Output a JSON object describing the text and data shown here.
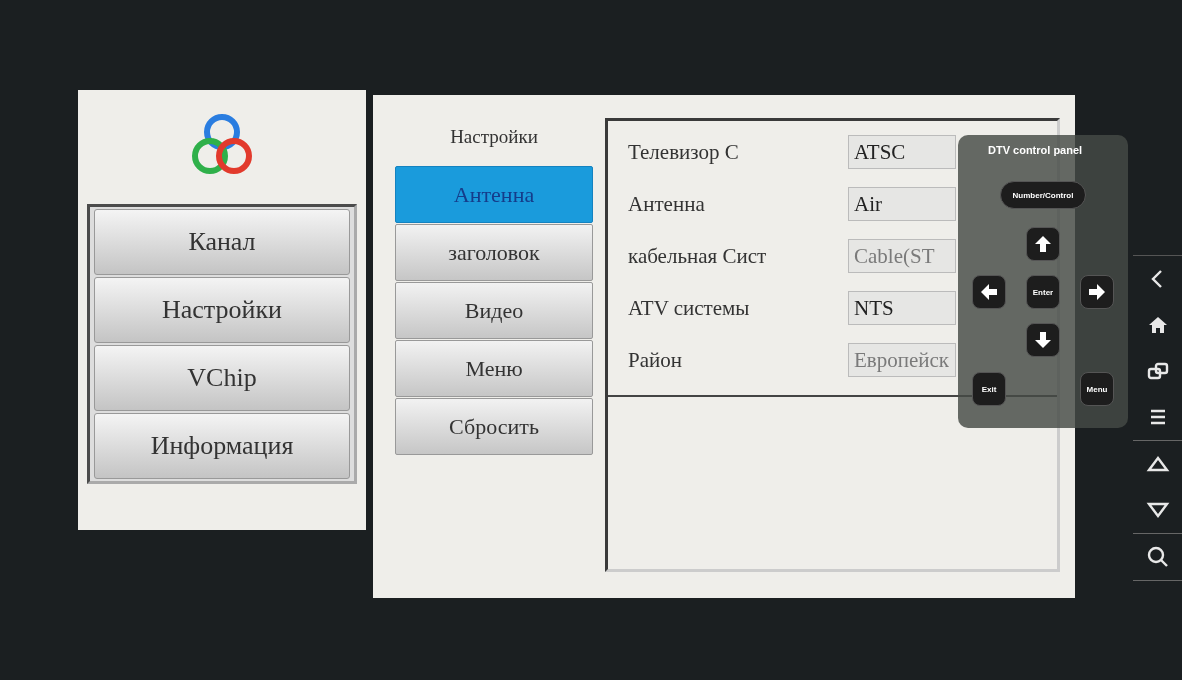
{
  "main_menu": [
    {
      "label": "Канал"
    },
    {
      "label": "Настройки"
    },
    {
      "label": "VChip"
    },
    {
      "label": "Информация"
    }
  ],
  "settings": {
    "title": "Настройки",
    "tabs": [
      {
        "label": "Антенна",
        "selected": true
      },
      {
        "label": "заголовок",
        "selected": false
      },
      {
        "label": "Видео",
        "selected": false
      },
      {
        "label": "Меню",
        "selected": false
      },
      {
        "label": "Сбросить",
        "selected": false
      }
    ],
    "rows": [
      {
        "label": "Телевизор С",
        "value": "ATSC",
        "disabled": false
      },
      {
        "label": "Антенна",
        "value": "Air",
        "disabled": false
      },
      {
        "label": "кабельная Сист",
        "value": "Cable(ST",
        "disabled": true
      },
      {
        "label": "ATV системы",
        "value": "NTS",
        "disabled": false
      },
      {
        "label": "Район",
        "value": "Европейск",
        "disabled": true
      }
    ]
  },
  "control_panel": {
    "title": "DTV control panel",
    "mode_button": "Number/Control",
    "enter": "Enter",
    "exit": "Exit",
    "menu": "Menu"
  }
}
